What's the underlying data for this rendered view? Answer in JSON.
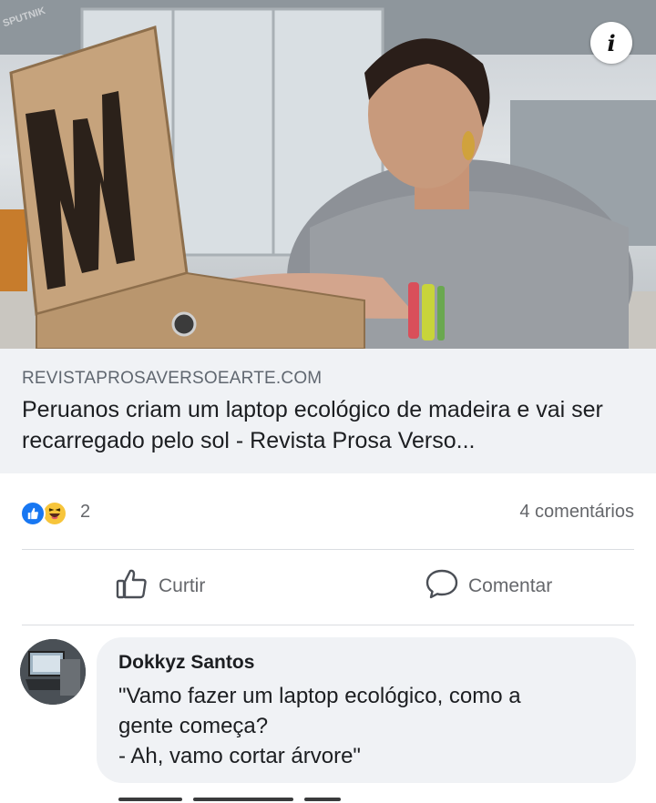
{
  "post": {
    "image": {
      "watermark": "SPUTNIK",
      "info_button": "i",
      "laptop_logo": "W"
    },
    "link": {
      "domain": "REVISTAPROSAVERSOEARTE.COM",
      "title": "Peruanos criam um laptop ecológico de madeira e vai ser recarregado pelo sol - Revista Prosa Verso..."
    },
    "reactions": {
      "icons": [
        "like-icon",
        "haha-icon"
      ],
      "count": "2",
      "comments_label": "4 comentários"
    },
    "actions": {
      "like_label": "Curtir",
      "comment_label": "Comentar"
    },
    "comments": [
      {
        "author": "Dokkyz Santos",
        "text": "\"Vamo fazer um laptop ecológico, como a\ngente começa?\n- Ah, vamo cortar árvore\""
      }
    ]
  },
  "colors": {
    "card_background": "#f0f2f5",
    "secondary_text": "#65676b",
    "like_blue": "#1877f2",
    "haha_yellow": "#f7c53b",
    "divider": "#dadde1"
  }
}
